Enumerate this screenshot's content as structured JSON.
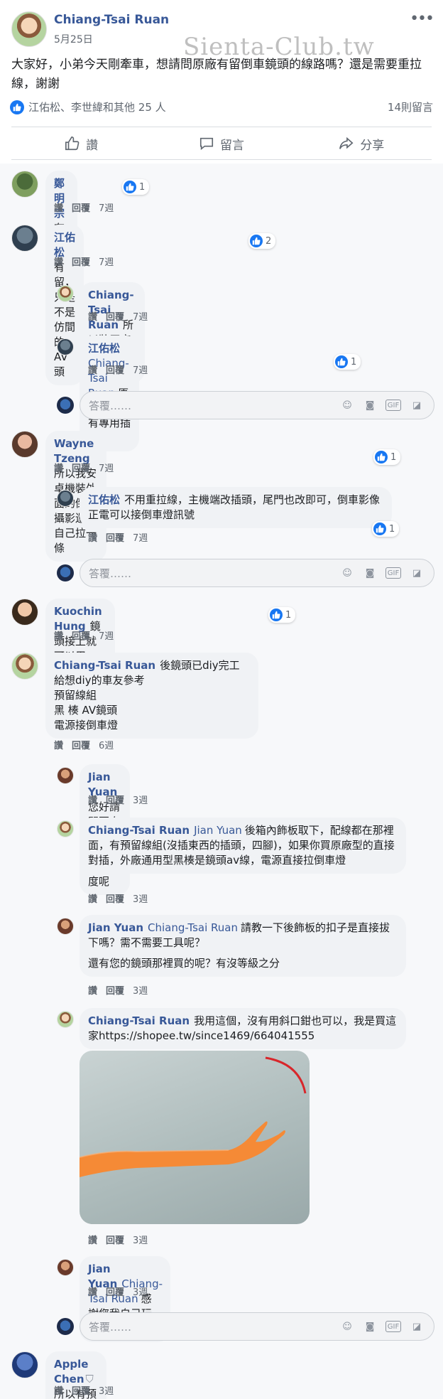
{
  "post": {
    "author": "Chiang-Tsai Ruan",
    "date": "5月25日",
    "watermark": "Sienta-Club.tw",
    "text": "大家好，小弟今天剛牽車，想請問原廠有留倒車鏡頭的線路嗎？還是需要重拉線，謝謝",
    "reactions_text": "江佑松、李世緯和其他 25 人",
    "comment_count": "14則留言",
    "actions": {
      "like": "讚",
      "comment": "留言",
      "share": "分享"
    }
  },
  "labels": {
    "like": "讚",
    "reply": "回覆",
    "reply_placeholder": "答覆……"
  },
  "comments": [
    {
      "name": "鄭明宗",
      "text": "有留",
      "reactions": "1",
      "time": "7週"
    },
    {
      "name": "江佑松",
      "text": "有留，只是不是仿間的AV頭",
      "reactions": "2",
      "time": "7週"
    },
    {
      "name": "Chiang-Tsai Ruan",
      "text": "所以裝原廠就可以不用拉線？",
      "time": "7週"
    },
    {
      "name": "江佑松",
      "mention": "Chiang-Tsai Ruan",
      "text": "原廠安裝會有專用插頭",
      "reactions": "1",
      "time": "7週"
    },
    {
      "name": "Wayne Tzeng",
      "text": "所以我安卓機裝外面的倒車攝影還是自己拉一條",
      "reactions": "1",
      "time": "7週"
    },
    {
      "name": "江佑松",
      "text": "不用重拉線，主機端改插頭，尾門也改即可，倒車影像正電可以接倒車燈訊號",
      "reactions": "1",
      "time": "7週"
    },
    {
      "name": "Kuochin Hung",
      "text": "鏡頭接上就可以用了！",
      "reactions": "1",
      "time": "7週"
    },
    {
      "name": "Chiang-Tsai Ruan",
      "text": "後鏡頭已diy完工",
      "lines": [
        "給想diy的車友參考",
        "預留線組",
        "黑 楱 AV鏡頭",
        "電源接倒車燈"
      ],
      "time": "6週"
    },
    {
      "name": "Jian Yuan",
      "text": "您好請問要自己diy須拆到什麼程度呢",
      "time": "3週"
    },
    {
      "name": "Chiang-Tsai Ruan",
      "mention": "Jian Yuan",
      "text": "後箱內飾板取下，配線都在那裡面，有預留線組(沒插東西的插頭，四腳)，如果你買原廠型的直接對插，外廠通用型黑楱是鏡頭av線，電源直接拉倒車燈",
      "time": "3週"
    },
    {
      "name": "Jian Yuan",
      "mention": "Chiang-Tsai Ruan",
      "text": "請教一下後飾板的扣子是直接拔下嗎？需不需要工具呢？",
      "text2": "還有您的鏡頭那裡買的呢？有沒等級之分",
      "time": "3週"
    },
    {
      "name": "Chiang-Tsai Ruan",
      "text": "我用這個，沒有用斜口鉗也可以，我是買這家https://shopee.tw/since1469/664041555",
      "time": "3週"
    },
    {
      "name": "Jian Yuan",
      "mention": "Chiang-Tsai Ruan",
      "text": "感謝您我自己玩看看謝謝",
      "time": "3週"
    },
    {
      "name": "Apple Chen",
      "text": "所以有預留線組喔！真好",
      "time": "3週"
    }
  ],
  "colors": {
    "link": "#385898",
    "like_blue": "#1877f2",
    "bubble": "#f0f2f5"
  },
  "icons": [
    "thumbs-up-icon",
    "comment-icon",
    "share-icon",
    "smiley-icon",
    "camera-icon",
    "gif-icon",
    "sticker-icon",
    "more-dots-icon",
    "shield-icon"
  ]
}
